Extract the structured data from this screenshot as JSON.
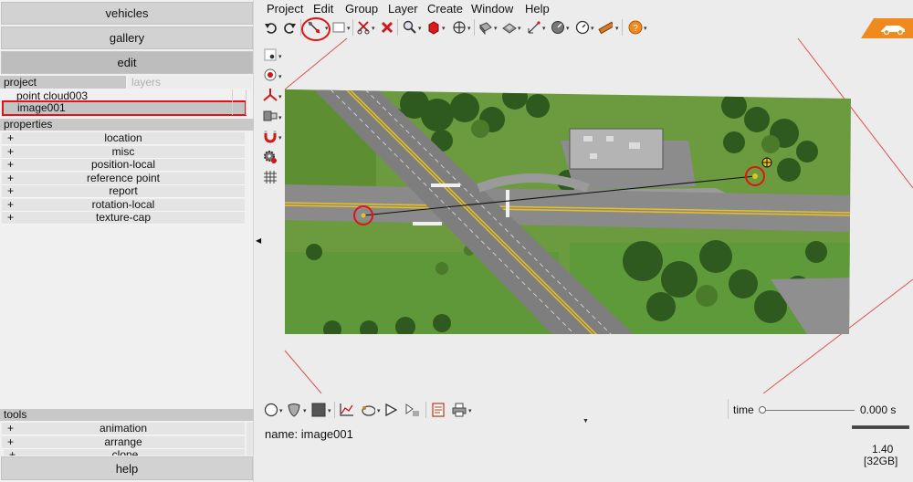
{
  "left_panel": {
    "top_buttons": [
      "vehicles",
      "gallery",
      "edit"
    ],
    "tabs": {
      "project": "project",
      "layers": "layers"
    },
    "tree": [
      "point cloud003",
      "image001"
    ],
    "properties_header": "properties",
    "properties": [
      "location",
      "misc",
      "position-local",
      "reference point",
      "report",
      "rotation-local",
      "texture-cap"
    ],
    "tools_header": "tools",
    "tools": [
      "animation",
      "arrange",
      "clone"
    ],
    "help_button": "help",
    "expander": "+"
  },
  "menu": [
    "Project",
    "Edit",
    "Group",
    "Layer",
    "Create",
    "Window",
    "Help"
  ],
  "toolbar_icons": [
    "undo-icon",
    "redo-icon",
    "measure-icon",
    "rectangle-select-icon",
    "cut-icon",
    "delete-icon",
    "zoom-icon",
    "cube-icon",
    "move-icon",
    "plane-icon",
    "layer-icon",
    "rotate-icon",
    "gauge-icon",
    "clock-icon",
    "ruler-icon",
    "help-icon"
  ],
  "side_icons": [
    "point-add-icon",
    "record-icon",
    "axes-icon",
    "camera-icon",
    "magnet-icon",
    "gear-icon",
    "grid-icon"
  ],
  "bottom": {
    "name_label": "name: image001",
    "time_label": "time",
    "time_value": "0.000 s",
    "zoom_value": "1.40",
    "memory": "[32GB]"
  },
  "colors": {
    "highlight_red": "#e01414",
    "logo_orange": "#f08a1e",
    "panel_bg": "#f0f0f0",
    "header_gray": "#c8c8c8"
  }
}
